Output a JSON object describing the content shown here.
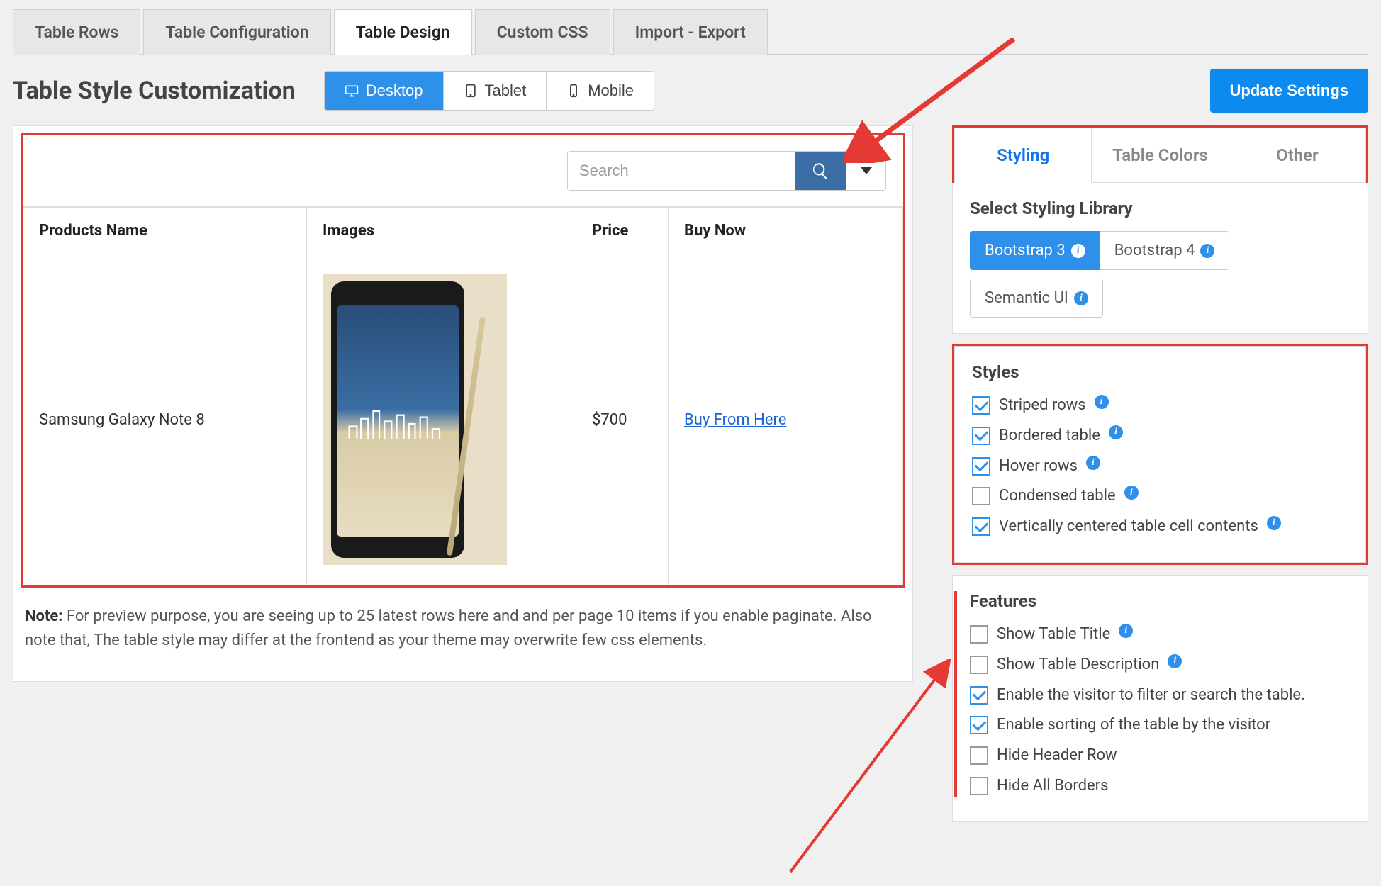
{
  "tabs": [
    "Table Rows",
    "Table Configuration",
    "Table Design",
    "Custom CSS",
    "Import - Export"
  ],
  "active_tab_index": 2,
  "page_title": "Table Style Customization",
  "devices": {
    "desktop": "Desktop",
    "tablet": "Tablet",
    "mobile": "Mobile",
    "active": "desktop"
  },
  "update_button": "Update Settings",
  "search": {
    "placeholder": "Search"
  },
  "columns": {
    "name": "Products Name",
    "images": "Images",
    "price": "Price",
    "buy": "Buy Now"
  },
  "row": {
    "name": "Samsung Galaxy Note 8",
    "price": "$700",
    "buy_link": "Buy From Here"
  },
  "note_label": "Note:",
  "note_text": "For preview purpose, you are seeing up to 25 latest rows here and and per page 10 items if you enable paginate. Also note that, The table style may differ at the frontend as your theme may overwrite few css elements.",
  "right_tabs": {
    "styling": "Styling",
    "colors": "Table Colors",
    "other": "Other",
    "active": "styling"
  },
  "library_heading": "Select Styling Library",
  "libraries": {
    "b3": "Bootstrap 3",
    "b4": "Bootstrap 4",
    "semantic": "Semantic UI",
    "active": "b3"
  },
  "styles_heading": "Styles",
  "styles": {
    "striped": {
      "label": "Striped rows",
      "checked": true
    },
    "bordered": {
      "label": "Bordered table",
      "checked": true
    },
    "hover": {
      "label": "Hover rows",
      "checked": true
    },
    "condensed": {
      "label": "Condensed table",
      "checked": false
    },
    "vcenter": {
      "label": "Vertically centered table cell contents",
      "checked": true
    }
  },
  "features_heading": "Features",
  "features": {
    "title": {
      "label": "Show Table Title",
      "checked": false
    },
    "desc": {
      "label": "Show Table Description",
      "checked": false
    },
    "filter": {
      "label": "Enable the visitor to filter or search the table.",
      "checked": true
    },
    "sort": {
      "label": "Enable sorting of the table by the visitor",
      "checked": true
    },
    "hidehdr": {
      "label": "Hide Header Row",
      "checked": false
    },
    "hidebord": {
      "label": "Hide All Borders",
      "checked": false
    }
  }
}
